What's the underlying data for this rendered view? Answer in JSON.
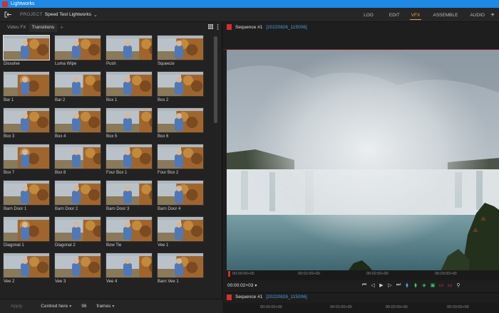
{
  "window": {
    "title": "Lightworks"
  },
  "topbar": {
    "project_label": "PROJECT",
    "project_name": "Speed Test Lightworks",
    "modes": [
      "LOG",
      "EDIT",
      "VFX",
      "ASSEMBLE",
      "AUDIO"
    ],
    "active_mode": "VFX"
  },
  "effects_panel": {
    "tabs": [
      "Video FX",
      "Transitions"
    ],
    "active_tab": "Transitions",
    "items": [
      "Dissolve",
      "Luma Wipe",
      "Push",
      "Squeeze",
      "Bar 1",
      "Bar 2",
      "Box 1",
      "Box 2",
      "Box 3",
      "Box 4",
      "Box 5",
      "Box 6",
      "Box 7",
      "Box 8",
      "Four Box 1",
      "Four Box 2",
      "Barn Door 1",
      "Barn Door 2",
      "Barn Door 3",
      "Barn Door 4",
      "Diagonal 1",
      "Diagonal 2",
      "Bow Tie",
      "Vee 1",
      "Vee 2",
      "Vee 3",
      "Vee 4",
      "Barn Vee 1"
    ],
    "selected_item": "Dissolve",
    "bottom": {
      "apply_label": "Apply",
      "position_option": "Centred here",
      "duration_value": "96",
      "units_option": "frames"
    }
  },
  "viewer": {
    "sequence_name": "Sequence #1",
    "sequence_stamp": "[20220826_115006]",
    "timecode": "00:00:02+03",
    "ruler_marks": [
      "00:00:00+00",
      "00:01:00+00",
      "00:02:00+00",
      "00:03:00+00"
    ]
  },
  "timeline": {
    "sequence_name": "Sequence #1",
    "sequence_stamp": "[20220826_115006]",
    "ruler_marks": [
      "00:00:00+00",
      "00:01:00+00",
      "00:02:00+00",
      "00:03:00+00"
    ]
  }
}
